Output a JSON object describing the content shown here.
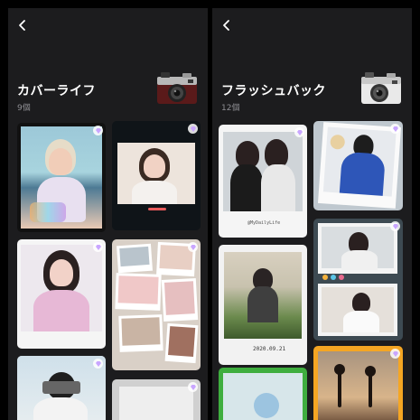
{
  "left": {
    "title": "カバーライフ",
    "count": "9個",
    "back_icon": "chevron-left-icon",
    "camera_icon": "retro-camera-icon-red"
  },
  "right": {
    "title": "フラッシュバック",
    "count": "12個",
    "back_icon": "chevron-left-icon",
    "camera_icon": "retro-camera-icon-white"
  },
  "cards": {
    "flash_1_caption": "@MyDailyLife",
    "flash_2_caption": "2020.09.21"
  },
  "colors": {
    "panel_bg": "#1c1c1e",
    "count_text": "#8e8e93",
    "accent_orange": "#f5a623",
    "accent_green": "#3fae3f"
  }
}
